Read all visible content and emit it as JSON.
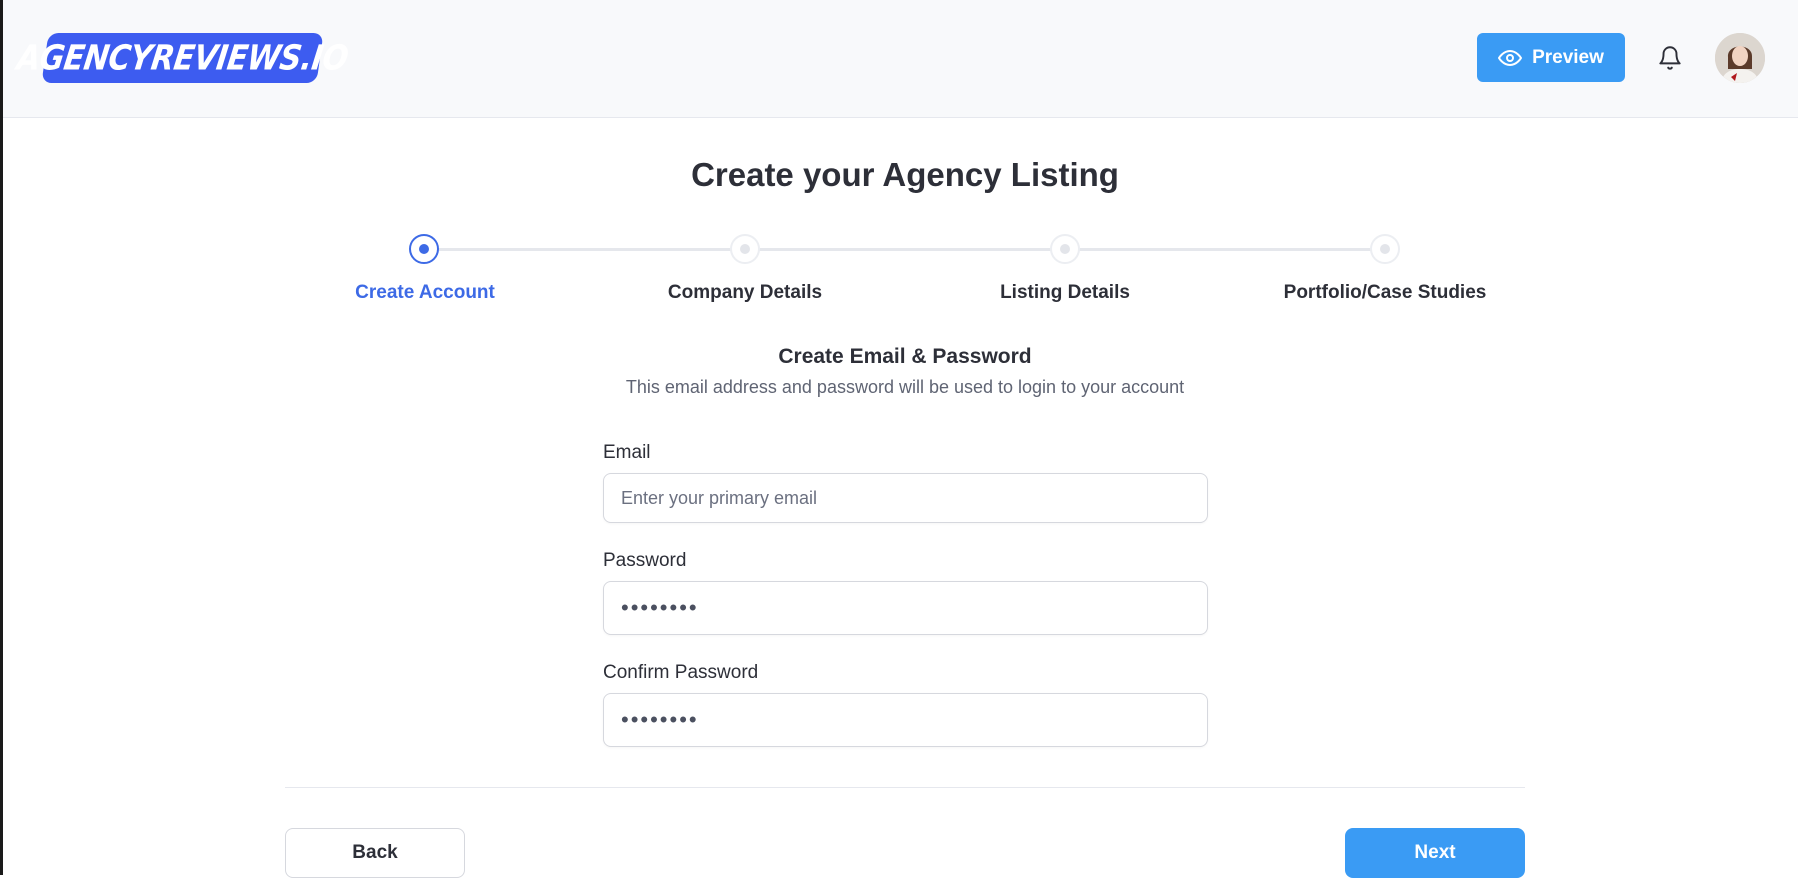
{
  "header": {
    "logo_text": "AGENCYREVIEWS.IO",
    "preview_label": "Preview",
    "brand_color": "#3d5cf0",
    "accent_color": "#3a9bf4"
  },
  "page": {
    "title": "Create your Agency Listing"
  },
  "stepper": {
    "steps": [
      {
        "label": "Create Account",
        "active": true
      },
      {
        "label": "Company Details",
        "active": false
      },
      {
        "label": "Listing Details",
        "active": false
      },
      {
        "label": "Portfolio/Case Studies",
        "active": false
      }
    ],
    "active_color": "#3d6ae6"
  },
  "form": {
    "heading": "Create Email & Password",
    "subheading": "This email address and password will be used to login to your account",
    "email": {
      "label": "Email",
      "placeholder": "Enter your primary email",
      "value": ""
    },
    "password": {
      "label": "Password",
      "value": "••••••••"
    },
    "confirm_password": {
      "label": "Confirm Password",
      "value": "••••••••"
    }
  },
  "footer": {
    "back_label": "Back",
    "next_label": "Next"
  }
}
